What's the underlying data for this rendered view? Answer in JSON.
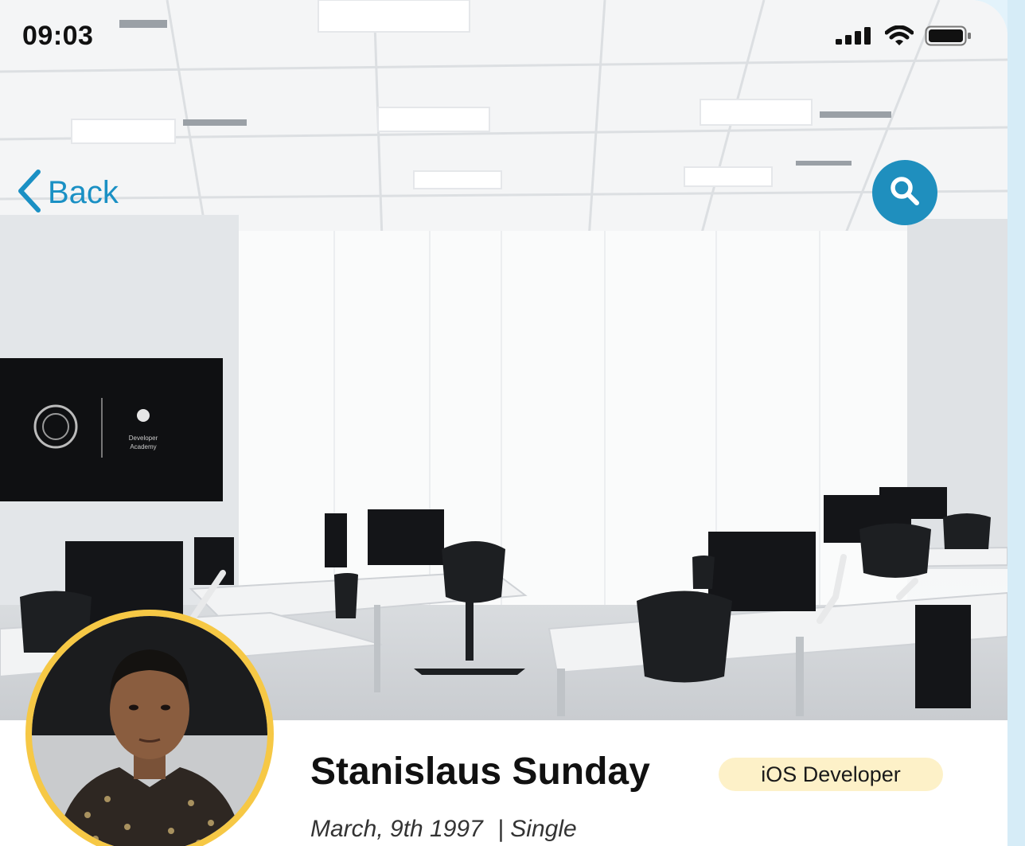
{
  "status_bar": {
    "time": "09:03"
  },
  "nav": {
    "back_label": "Back"
  },
  "screen": {
    "tv_brand_line1": "Developer",
    "tv_brand_line2": "Academy"
  },
  "profile": {
    "name": "Stanislaus Sunday",
    "role": "iOS Developer",
    "birthdate": "March, 9th 1997",
    "separator": "|",
    "status": "Single"
  },
  "colors": {
    "accent": "#1f8fbe",
    "avatar_ring": "#f6c845",
    "badge_bg": "#fdf1c8"
  },
  "icons": [
    "chevron-left-icon",
    "search-icon",
    "signal-icon",
    "wifi-icon",
    "battery-icon"
  ]
}
